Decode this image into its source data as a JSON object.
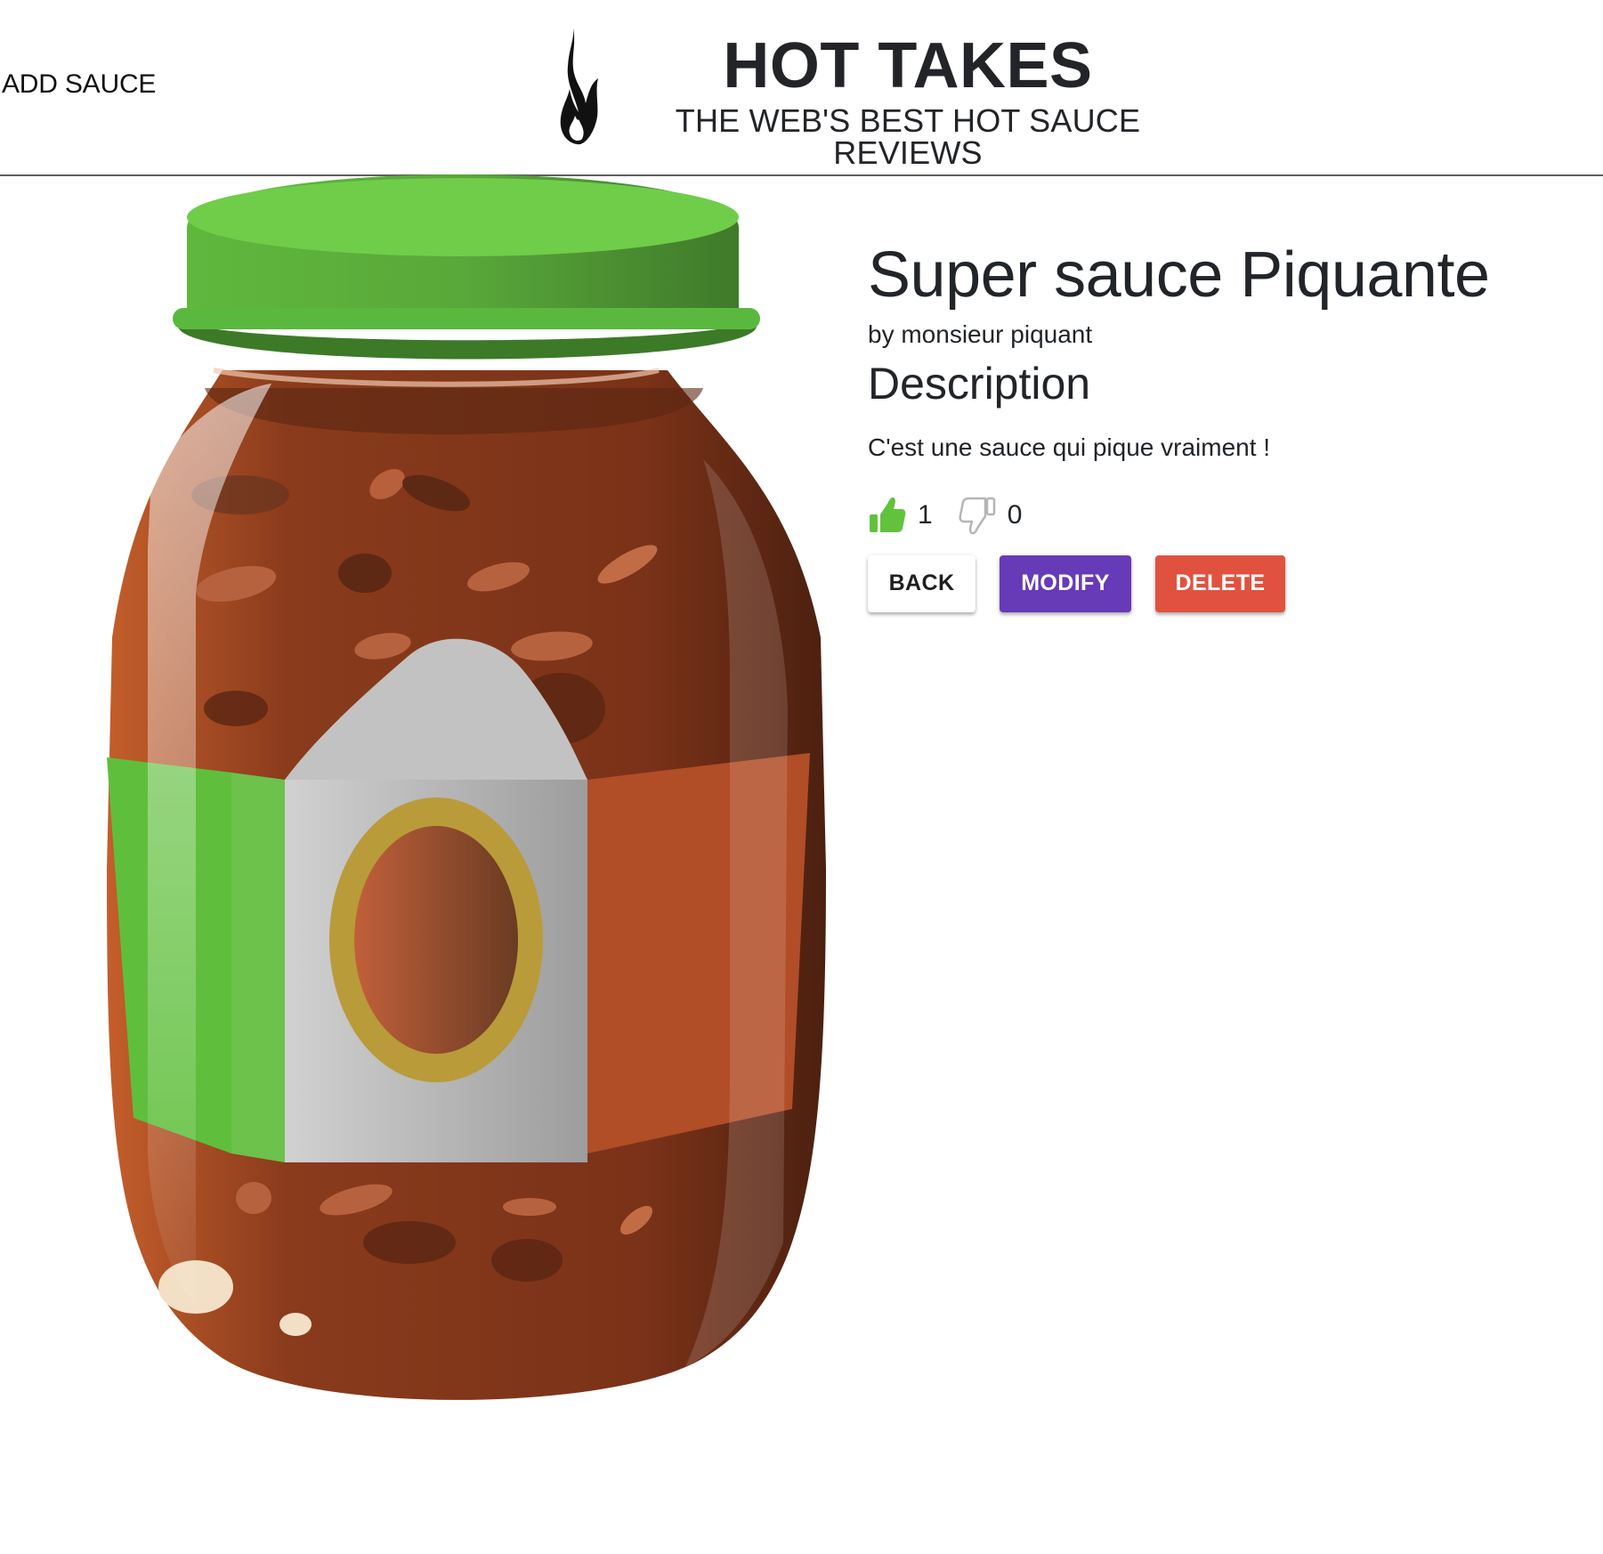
{
  "header": {
    "add_sauce_link": "ADD SAUCE",
    "brand_title": "HOT TAKES",
    "brand_tagline": "THE WEB'S BEST HOT SAUCE REVIEWS",
    "logo_icon": "flame-icon"
  },
  "sauce": {
    "name": "Super sauce Piquante",
    "manufacturer": "by monsieur piquant",
    "description_heading": "Description",
    "description": "C'est une sauce qui pique vraiment !",
    "image_icon": "sauce-jar-image",
    "likes": "1",
    "dislikes": "0",
    "like_icon": "thumbs-up-icon",
    "dislike_icon": "thumbs-down-icon"
  },
  "actions": {
    "back_label": "BACK",
    "modify_label": "MODIFY",
    "delete_label": "DELETE"
  },
  "colors": {
    "modify_button": "#673ab7",
    "delete_button": "#e0523f",
    "like_active": "#62c23d",
    "dislike_inactive": "#b5b5b5",
    "jar_lid": "#6cc24a",
    "jar_body": "#8a3b1c"
  }
}
